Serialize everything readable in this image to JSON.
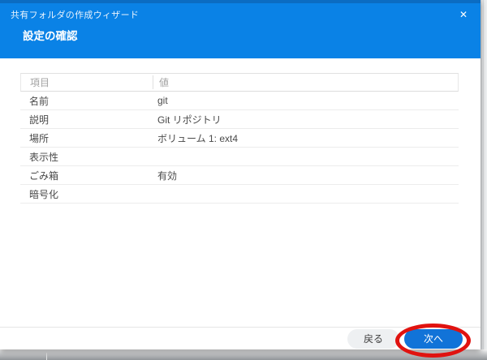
{
  "dialog": {
    "title": "共有フォルダの作成ウィザード",
    "subtitle": "設定の確認",
    "close_icon": "✕"
  },
  "table": {
    "columns": [
      "項目",
      "値"
    ],
    "rows": [
      {
        "label": "名前",
        "value": "git"
      },
      {
        "label": "説明",
        "value": "Git リポジトリ"
      },
      {
        "label": "場所",
        "value": "ボリューム 1:  ext4"
      },
      {
        "label": "表示性",
        "value": ""
      },
      {
        "label": "ごみ箱",
        "value": "有効"
      },
      {
        "label": "暗号化",
        "value": ""
      }
    ]
  },
  "footer": {
    "back": "戻る",
    "next": "次へ"
  },
  "annotation": {
    "type": "red-ellipse",
    "target": "next-button",
    "color": "#e01310"
  },
  "colors": {
    "header_blue": "#0a82e6",
    "header_top_strip": "#0b6cc2",
    "button_blue": "#1173d8",
    "back_button_bg": "#eef0f2",
    "annotation_red": "#e01310"
  }
}
